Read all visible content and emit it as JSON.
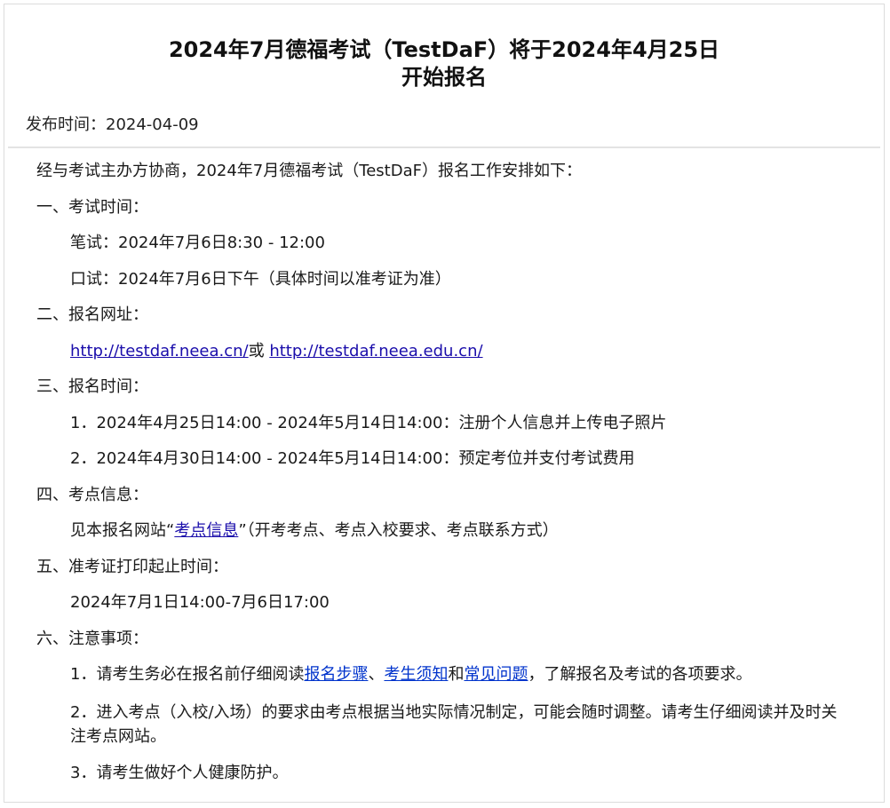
{
  "title": {
    "line1": "2024年7月德福考试（TestDaF）将于2024年4月25日",
    "line2": "开始报名"
  },
  "meta": {
    "publish_label": "发布时间：",
    "publish_date": "2024-04-09"
  },
  "intro": "经与考试主办方协商，2024年7月德福考试（TestDaF）报名工作安排如下：",
  "sections": {
    "s1": {
      "heading": "一、考试时间：",
      "written": "笔试：2024年7月6日8:30 - 12:00",
      "oral": "口试：2024年7月6日下午（具体时间以准考证为准）"
    },
    "s2": {
      "heading": "二、报名网址：",
      "link1": "http://testdaf.neea.cn/",
      "or": "或",
      "link2": "http://testdaf.neea.edu.cn/"
    },
    "s3": {
      "heading": "三、报名时间：",
      "item1": "1．2024年4月25日14:00 - 2024年5月14日14:00：注册个人信息并上传电子照片",
      "item2": "2．2024年4月30日14:00 - 2024年5月14日14:00：预定考位并支付考试费用"
    },
    "s4": {
      "heading": "四、考点信息：",
      "prefix": "见本报名网站“",
      "link": "考点信息",
      "suffix": "”（开考考点、考点入校要求、考点联系方式）"
    },
    "s5": {
      "heading": "五、准考证打印起止时间：",
      "text": "2024年7月1日14:00-7月6日17:00"
    },
    "s6": {
      "heading": "六、注意事项：",
      "item1_prefix": "1．请考生务必在报名前仔细阅读",
      "item1_link1": "报名步骤",
      "item1_sep": "、",
      "item1_link2": "考生须知",
      "item1_and": "和",
      "item1_link3": "常见问题",
      "item1_suffix": "，了解报名及考试的各项要求。",
      "item2": "2．进入考点（入校/入场）的要求由考点根据当地实际情况制定，可能会随时调整。请考生仔细阅读并及时关注考点网站。",
      "item3": "3．请考生做好个人健康防护。"
    }
  },
  "colors": {
    "link": "#1a0dab",
    "link_alt": "#0033cc",
    "text": "#1a1a1a",
    "divider": "#e3e3e3"
  }
}
